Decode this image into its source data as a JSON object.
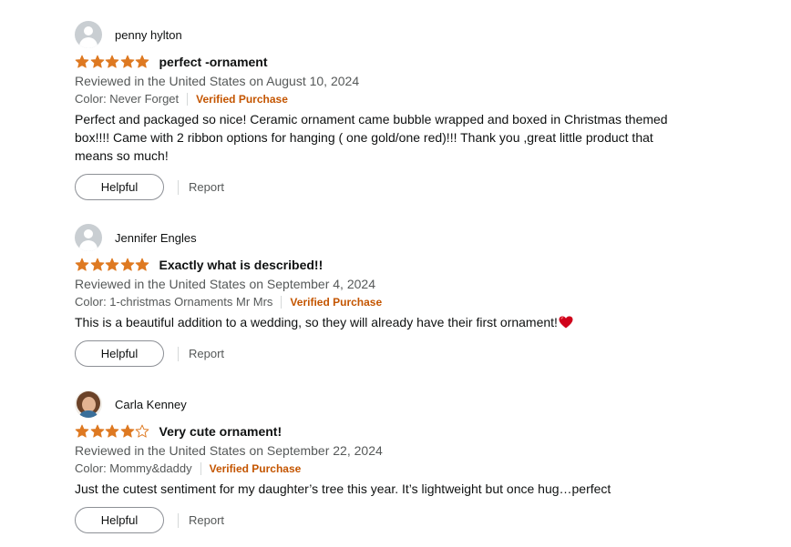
{
  "colors": {
    "star": "#de7921",
    "verified": "#c45500",
    "heart": "#d0021b",
    "muted_text": "#565959"
  },
  "reviews": [
    {
      "profile_name": "penny hylton",
      "avatar": "default-avatar-icon",
      "rating": 5,
      "title": "perfect -ornament",
      "reviewed_line": "Reviewed in the United States on August 10, 2024",
      "variant": "Color: Never Forget",
      "verified_label": "Verified Purchase",
      "body": "Perfect and packaged so nice! Ceramic ornament came bubble wrapped and boxed in Christmas themed box!!!! Came with 2 ribbon options for hanging ( one gold/one red)!!! Thank you ,great little product that means so much!",
      "helpful_label": "Helpful",
      "report_label": "Report"
    },
    {
      "profile_name": "Jennifer Engles",
      "avatar": "default-avatar-icon",
      "rating": 5,
      "title": "Exactly what is described!!",
      "reviewed_line": "Reviewed in the United States on September 4, 2024",
      "variant": "Color: 1-christmas Ornaments Mr Mrs",
      "verified_label": "Verified Purchase",
      "body": "This is a beautiful addition to a wedding, so they will already have their first ornament!",
      "body_emoji": "heart-emoji-icon",
      "helpful_label": "Helpful",
      "report_label": "Report"
    },
    {
      "profile_name": "Carla Kenney",
      "avatar": "photo-avatar",
      "rating": 4,
      "title": "Very cute ornament!",
      "reviewed_line": "Reviewed in the United States on September 22, 2024",
      "variant": "Color: Mommy&daddy",
      "verified_label": "Verified Purchase",
      "body": "Just the cutest sentiment for my daughter’s tree this year. It’s lightweight but once hug…perfect",
      "helpful_label": "Helpful",
      "report_label": "Report"
    }
  ]
}
